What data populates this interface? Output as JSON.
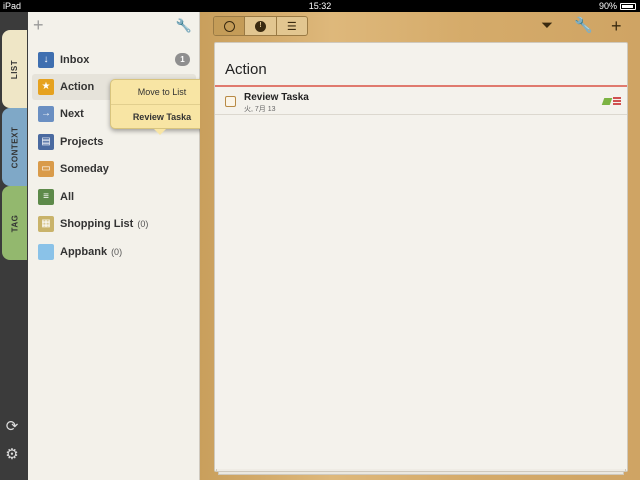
{
  "status": {
    "carrier": "iPad",
    "time": "15:32",
    "battery": "90%"
  },
  "tabs": [
    "LIST",
    "CONTEXT",
    "TAG"
  ],
  "sidebar": {
    "items": [
      {
        "label": "Inbox",
        "badge": "1",
        "count": ""
      },
      {
        "label": "Action",
        "badge": "",
        "count": ""
      },
      {
        "label": "Next",
        "badge": "",
        "count": ""
      },
      {
        "label": "Projects",
        "badge": "",
        "count": ""
      },
      {
        "label": "Someday",
        "badge": "",
        "count": ""
      },
      {
        "label": "All",
        "badge": "",
        "count": ""
      },
      {
        "label": "Shopping List",
        "badge": "",
        "count": "(0)"
      },
      {
        "label": "Appbank",
        "badge": "",
        "count": "(0)"
      }
    ]
  },
  "popover": {
    "move_label": "Move to List",
    "task_label": "Review Taska"
  },
  "main": {
    "title": "Action",
    "tasks": [
      {
        "title": "Review Taska",
        "date": "火, 7月 13"
      }
    ]
  },
  "colors": {
    "accent": "#e07a6e",
    "wood": "#d5ab6a",
    "tab_list": "#efe6c6",
    "tab_context": "#7fa8c7",
    "tab_tag": "#93b86e"
  }
}
